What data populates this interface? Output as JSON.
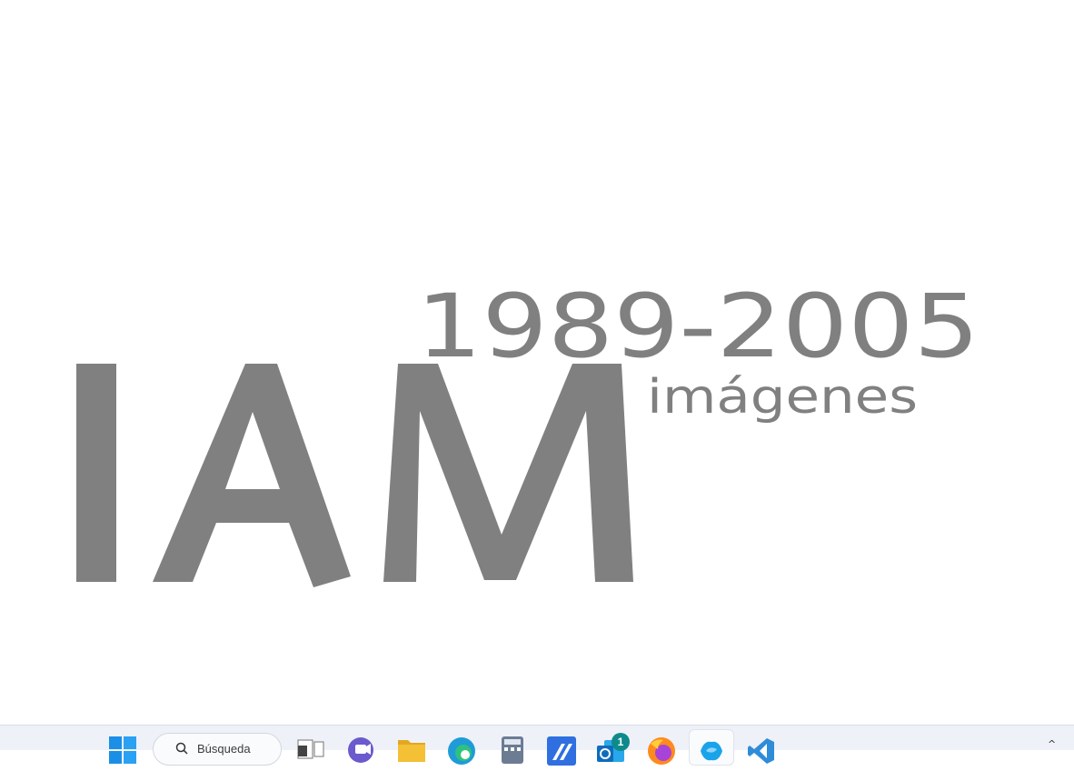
{
  "logo": {
    "years": "1989-2005",
    "subtitle": "imágenes",
    "letters": "IAM",
    "color": "#808080"
  },
  "taskbar": {
    "search_placeholder": "Búsqueda",
    "icons": [
      {
        "name": "windows-start-icon",
        "color": "#1b8fe6"
      },
      {
        "name": "task-view-icon",
        "color": "#555555"
      },
      {
        "name": "teams-chat-icon",
        "color": "#6a5acd"
      },
      {
        "name": "file-explorer-icon",
        "color": "#f3c036"
      },
      {
        "name": "edge-browser-icon",
        "color": "#1f9bd8"
      },
      {
        "name": "calculator-icon",
        "color": "#3a6fb5"
      },
      {
        "name": "kotlin-app-icon",
        "color": "#2f6fe0"
      },
      {
        "name": "outlook-icon",
        "color": "#0f6cbd"
      },
      {
        "name": "firefox-icon",
        "color": "#ff8a1d"
      },
      {
        "name": "copilot-icon",
        "color": "#1aa3e8"
      },
      {
        "name": "vscode-icon",
        "color": "#2f8cd9"
      }
    ],
    "mail_badge": "1",
    "tray_chevron": "^"
  }
}
